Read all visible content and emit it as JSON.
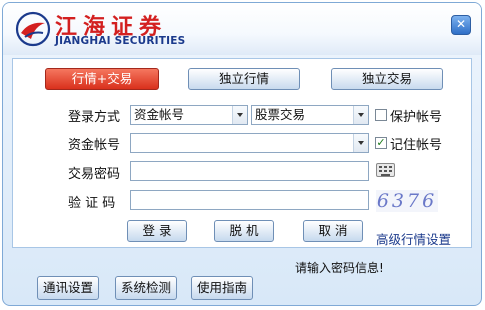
{
  "header": {
    "logo_cn": "江海证券",
    "logo_en": "JIANGHAI SECURITIES",
    "close_glyph": "✕",
    "close_icon": "close-icon"
  },
  "tabs": [
    {
      "label": "行情+交易",
      "selected": true
    },
    {
      "label": "独立行情",
      "selected": false
    },
    {
      "label": "独立交易",
      "selected": false
    }
  ],
  "form": {
    "login_type_label": "登录方式",
    "account_type_value": "资金帐号",
    "trade_type_value": "股票交易",
    "protect_account_label": "保护帐号",
    "protect_account_checked": false,
    "account_label": "资金帐号",
    "account_value": "",
    "remember_account_label": "记住帐号",
    "remember_account_checked": true,
    "password_label": "交易密码",
    "password_value": "",
    "captcha_label": "验 证 码",
    "captcha_value": "",
    "captcha_image_text": "6376",
    "keyboard_icon": "soft-keyboard-icon"
  },
  "actions": {
    "login": "登 录",
    "offline": "脱 机",
    "cancel": "取 消",
    "advanced_link": "高级行情设置"
  },
  "status_hint": "请输入密码信息!",
  "footer": {
    "comm_settings": "通讯设置",
    "system_check": "系统检测",
    "user_guide": "使用指南"
  },
  "colors": {
    "active_tab": "#d9301c",
    "logo_red": "#d32020",
    "logo_blue": "#1b3a8c",
    "window_bg": "#d8e8f8"
  }
}
